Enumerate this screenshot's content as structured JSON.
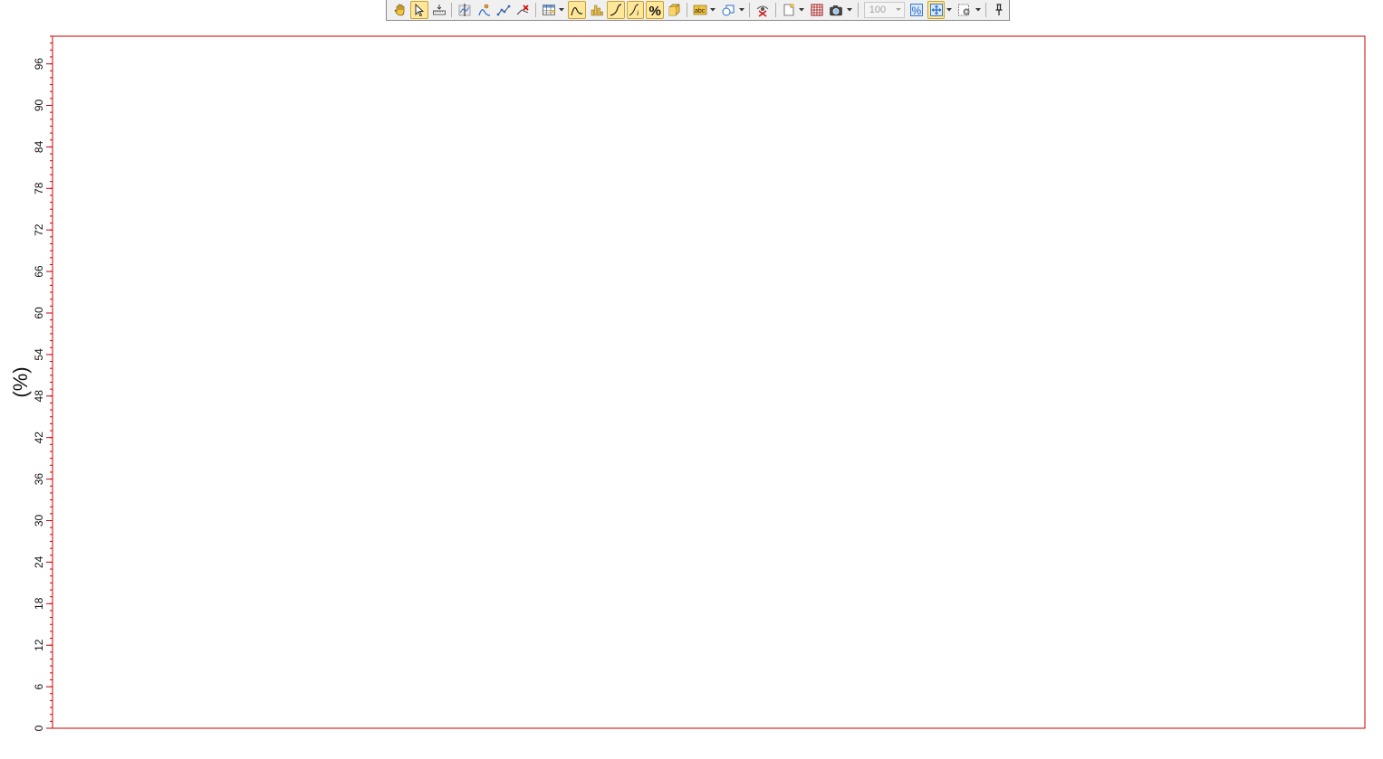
{
  "toolbar": {
    "buttons": [
      {
        "id": "pan",
        "icon": "hand-icon",
        "active": false
      },
      {
        "id": "select",
        "icon": "arrow-cursor-icon",
        "active": true
      },
      {
        "id": "measure",
        "icon": "ruler-icon",
        "active": false
      },
      {
        "id": "sep1",
        "separator": true
      },
      {
        "id": "cursor-line",
        "icon": "vertical-cursor-icon",
        "active": false
      },
      {
        "id": "peak-pick",
        "icon": "peak-person-icon",
        "active": false
      },
      {
        "id": "multi-point",
        "icon": "multi-point-icon",
        "active": false
      },
      {
        "id": "remove-point",
        "icon": "remove-point-icon",
        "active": false
      },
      {
        "id": "sep2",
        "separator": true
      },
      {
        "id": "grid",
        "icon": "grid-table-icon",
        "active": false,
        "dropdown": true
      },
      {
        "id": "curve-view",
        "icon": "curve-view-icon",
        "active": true
      },
      {
        "id": "histogram",
        "icon": "bar-chart-icon",
        "active": false
      },
      {
        "id": "cumulative",
        "icon": "cumulative-curve-icon",
        "active": true
      },
      {
        "id": "curve-info",
        "icon": "curve-info-icon",
        "active": true
      },
      {
        "id": "percent",
        "icon": "percent-icon",
        "active": true
      },
      {
        "id": "3d",
        "icon": "3d-box-icon",
        "active": false
      },
      {
        "id": "sep3",
        "separator": true
      },
      {
        "id": "label",
        "icon": "abc-label-icon",
        "active": false,
        "dropdown": true
      },
      {
        "id": "shapes",
        "icon": "shapes-icon",
        "active": false,
        "dropdown": true
      },
      {
        "id": "sep4",
        "separator": true
      },
      {
        "id": "reset-view",
        "icon": "reset-eye-icon",
        "active": false
      },
      {
        "id": "sep5",
        "separator": true
      },
      {
        "id": "page",
        "icon": "new-page-icon",
        "active": false,
        "dropdown": true
      },
      {
        "id": "table",
        "icon": "red-grid-icon",
        "active": false
      },
      {
        "id": "snapshot",
        "icon": "camera-icon",
        "active": false,
        "dropdown": true
      },
      {
        "id": "sep6",
        "separator": true
      },
      {
        "id": "zoom",
        "combo": true,
        "value": "100"
      },
      {
        "id": "zoom-percent",
        "icon": "zoom-percent-icon",
        "active": false
      },
      {
        "id": "fit",
        "icon": "fit-arrows-icon",
        "active": true,
        "dropdown": true
      },
      {
        "id": "settings",
        "icon": "settings-page-icon",
        "active": false,
        "dropdown": true
      },
      {
        "id": "sep7",
        "separator": true
      },
      {
        "id": "pin",
        "icon": "pin-icon",
        "active": false
      }
    ]
  },
  "chart_data": {
    "type": "line",
    "ylabel": "(%)",
    "xlabel": "",
    "title": "",
    "ylim": [
      0,
      100
    ],
    "yticks": [
      0,
      6,
      12,
      18,
      24,
      30,
      36,
      42,
      48,
      54,
      60,
      66,
      72,
      78,
      84,
      90,
      96
    ],
    "minor_tick_step": 1,
    "series": [],
    "frame_color": "#cc0000",
    "grid": false
  }
}
